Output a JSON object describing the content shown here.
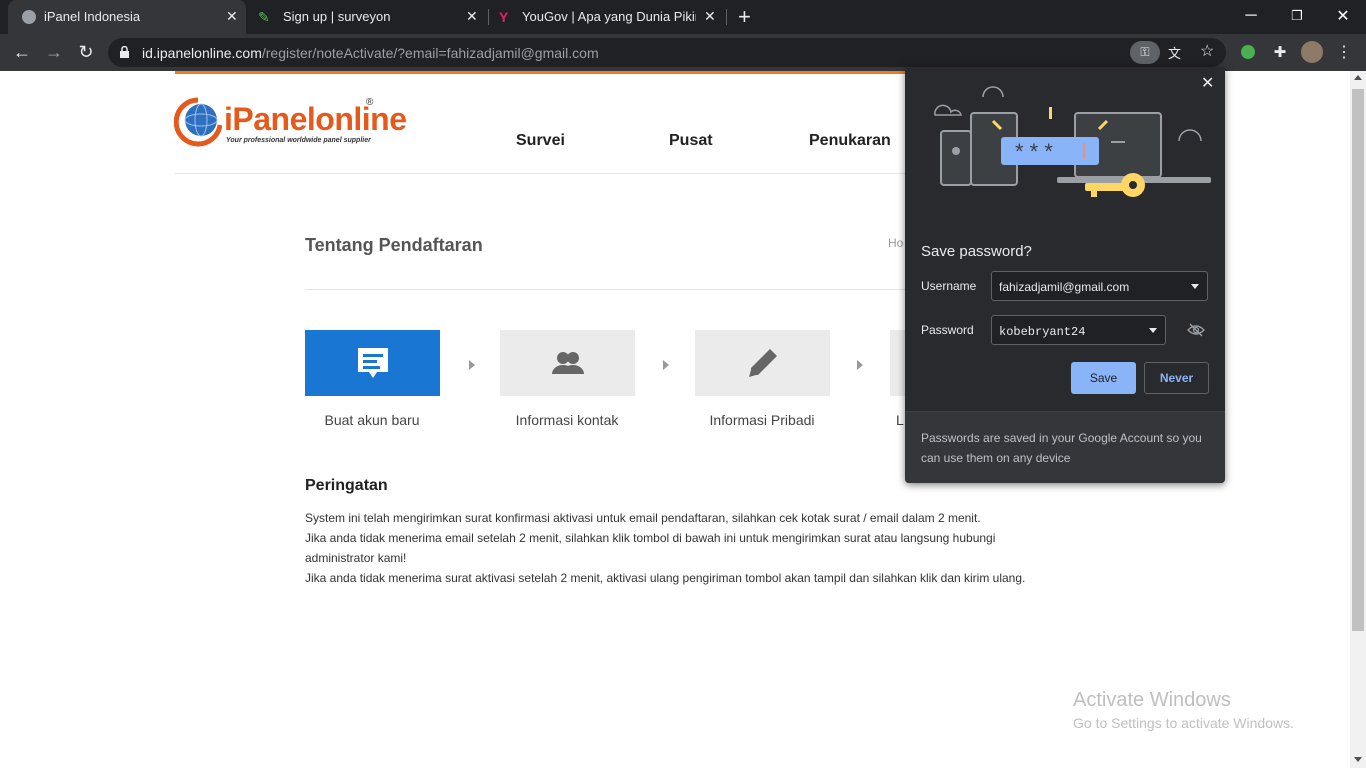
{
  "browser": {
    "tabs": [
      {
        "title": "iPanel Indonesia",
        "active": true
      },
      {
        "title": "Sign up | surveyon",
        "active": false
      },
      {
        "title": "YouGov | Apa yang Dunia Pikirkan",
        "active": false
      }
    ],
    "new_tab_label": "+",
    "url_host": "id.ipanelonline.com",
    "url_path": "/register/noteActivate/?email=fahizadjamil@gmail.com"
  },
  "site": {
    "logo_text": "iPanelonline",
    "logo_reg": "®",
    "logo_tagline": "Your professional worldwide panel supplier",
    "nav": [
      "Survei",
      "Pusat",
      "Penukaran"
    ],
    "section_title": "Tentang Pendaftaran",
    "breadcrumb": "Ho",
    "steps": [
      {
        "label": "Buat akun baru",
        "icon": "chat-bubble-icon",
        "active": true
      },
      {
        "label": "Informasi kontak",
        "icon": "users-icon",
        "active": false
      },
      {
        "label": "Informasi Pribadi",
        "icon": "pencil-icon",
        "active": false
      },
      {
        "label": "L",
        "icon": "",
        "active": false
      }
    ],
    "warning_title": "Peringatan",
    "warning_lines": [
      "System ini telah mengirimkan surat konfirmasi aktivasi untuk email pendaftaran, silahkan cek kotak surat / email dalam 2 menit.",
      "Jika anda tidak menerima email setelah 2 menit, silahkan klik tombol di bawah ini untuk mengirimkan surat atau langsung hubungi administrator kami!",
      "Jika anda tidak menerima surat aktivasi setelah 2 menit, aktivasi ulang pengiriman tombol akan tampil dan silahkan klik dan kirim ulang."
    ],
    "accent_color": "#1976d2",
    "orange_color": "#ef7d22"
  },
  "password_popup": {
    "title": "Save password?",
    "username_label": "Username",
    "username_value": "fahizadjamil@gmail.com",
    "password_label": "Password",
    "password_value": "kobebryant24",
    "save_label": "Save",
    "never_label": "Never",
    "footer": "Passwords are saved in your Google Account so you can use them on any device",
    "password_mask": "* * *"
  },
  "watermark": {
    "line1": "Activate Windows",
    "line2": "Go to Settings to activate Windows."
  }
}
